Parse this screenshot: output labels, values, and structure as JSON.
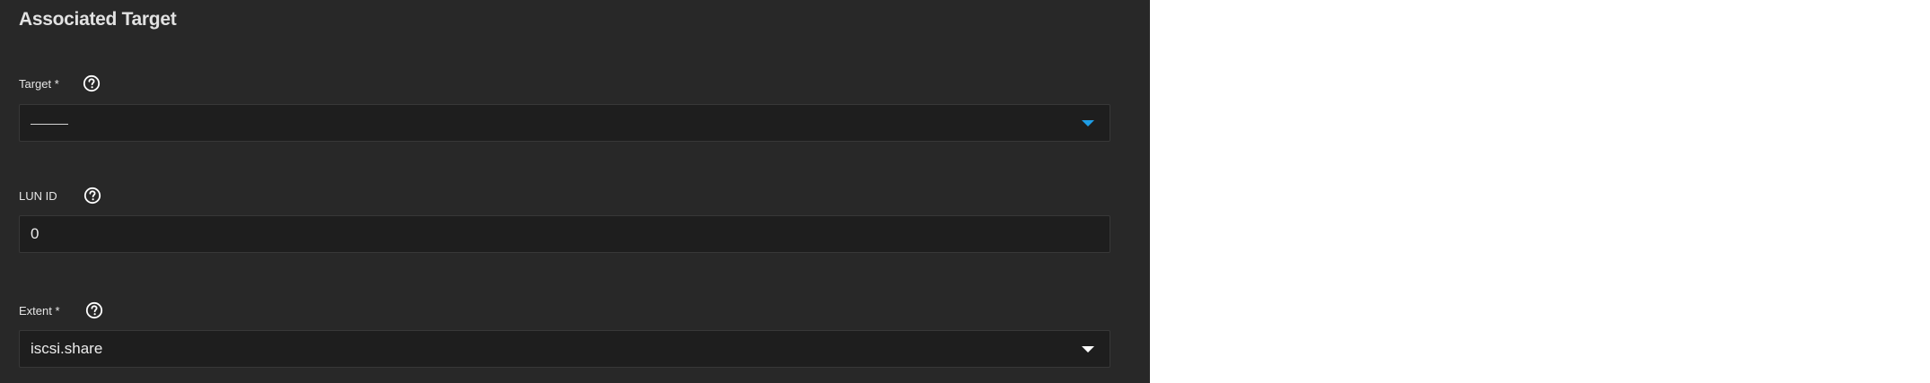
{
  "card": {
    "title": "Associated Target"
  },
  "fields": {
    "target": {
      "label": "Target *",
      "value": "———",
      "icon": "help-circle-icon"
    },
    "lun_id": {
      "label": "LUN ID",
      "value": "0",
      "icon": "help-circle-icon"
    },
    "extent": {
      "label": "Extent *",
      "value": "iscsi.share",
      "icon": "help-circle-icon"
    }
  },
  "colors": {
    "panel_bg": "#282828",
    "input_bg": "#1e1e1e",
    "accent": "#1e9de6",
    "text": "#e6e6e6"
  }
}
